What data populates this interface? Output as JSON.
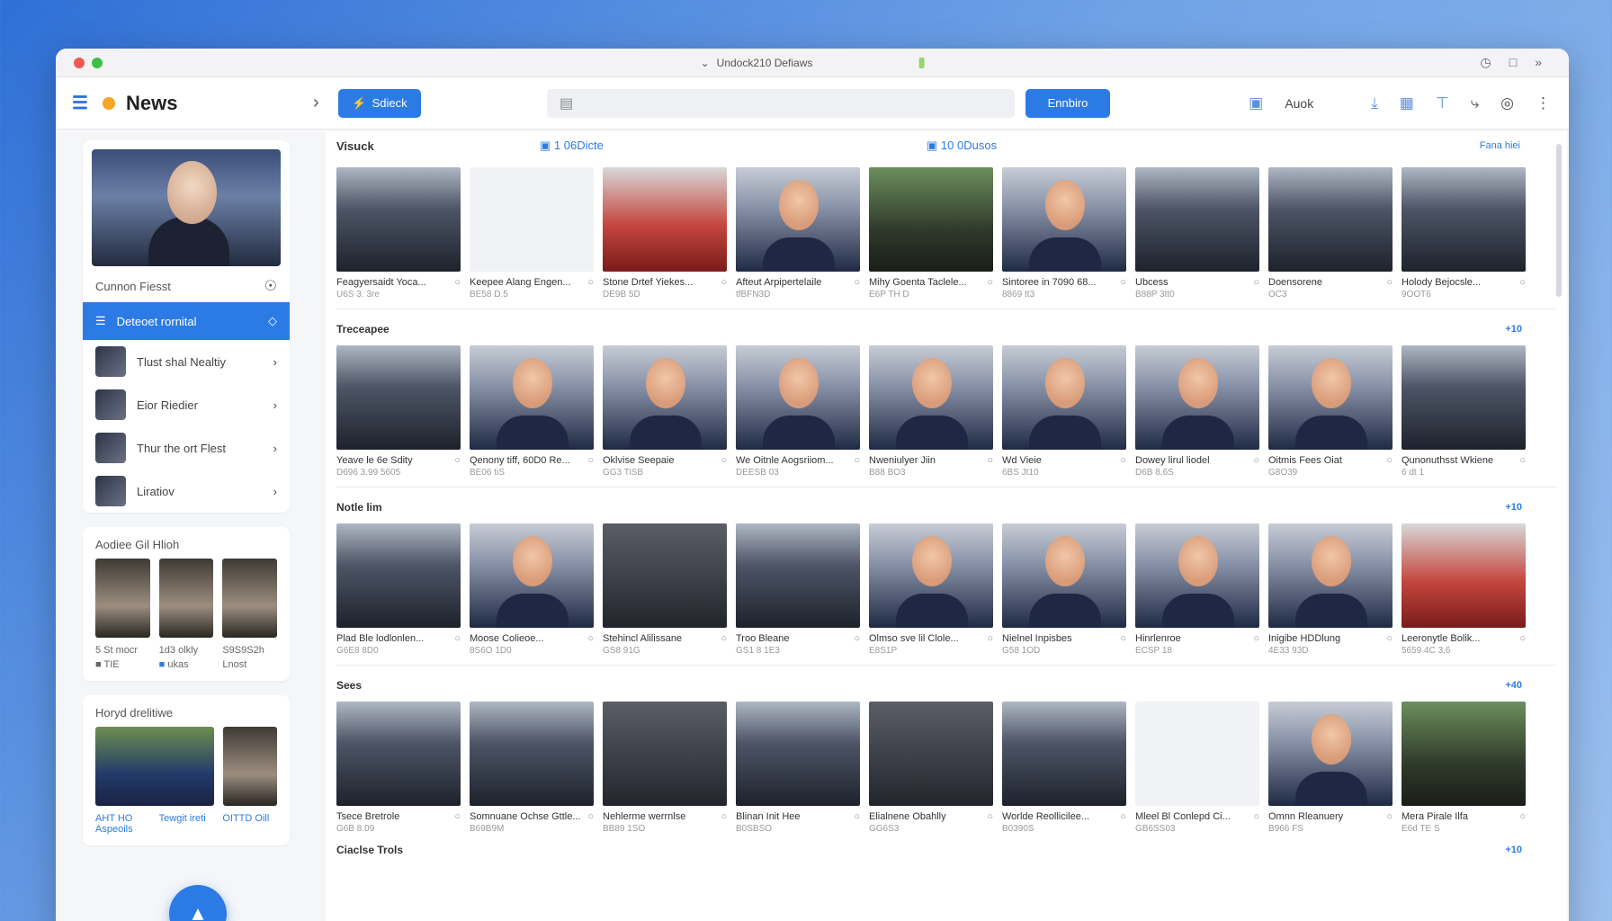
{
  "window": {
    "title": "Undock210 Defiaws"
  },
  "toolbar": {
    "app_title": "News",
    "primary_button": "Sdieck",
    "search_placeholder": "",
    "action_button": "Ennbiro",
    "text_item": "Auok"
  },
  "sidebar": {
    "section_title": "Cunnon Fiesst",
    "items": [
      {
        "label": "Deteoet rornital"
      },
      {
        "label": "Tlust shal Nealtiy"
      },
      {
        "label": "Eior Riedier"
      },
      {
        "label": "Thur the ort Flest"
      },
      {
        "label": "Liratiov"
      }
    ],
    "card2_title": "Aodiee Gil Hlioh",
    "card2_caps": [
      "5 St mocr",
      "1d3 olkly",
      "S9S9S2h"
    ],
    "card2_caps2": [
      "TIE",
      "ukas",
      "Lnost"
    ],
    "card3_title": "Horyd drelitiwe",
    "card3_caps": [
      "AHT HO Aspeoils",
      "Tewgit ireti",
      "OITTD Oill"
    ]
  },
  "main": {
    "view_label": "Visuck",
    "tag1": "1 06Dicte",
    "tag2": "10 0Dusos",
    "tag3": "Fana hiei",
    "sections": [
      {
        "title": "",
        "more": "",
        "tiles": [
          {
            "cap": "Feagyersaidt Yoca...",
            "sub": "U6S 3. 3re"
          },
          {
            "cap": "Keepee Alang Engen...",
            "sub": "BE58 D.5"
          },
          {
            "cap": "Stone Drtef Yiekes...",
            "sub": "DE9B 5D"
          },
          {
            "cap": "Afteut Arpipertelaile",
            "sub": "tfBFN3D"
          },
          {
            "cap": "Mihy Goenta Taclele...",
            "sub": "E6P TH D"
          },
          {
            "cap": "Sintoree in 7090 68...",
            "sub": "8869 tt3"
          },
          {
            "cap": "Ubcess",
            "sub": "B88P 3tt0"
          },
          {
            "cap": "Doensorene",
            "sub": "OC3"
          },
          {
            "cap": "Holody Bejocsle...",
            "sub": "9OOT6"
          }
        ]
      },
      {
        "title": "Treceapee",
        "more": "+10",
        "tiles": [
          {
            "cap": "Yeave le 6e Sdity",
            "sub": "D696 3.99 5605"
          },
          {
            "cap": "Qenony tiff, 60D0 Re...",
            "sub": "BE06 tiS"
          },
          {
            "cap": "Oklvise Seepaie",
            "sub": "GG3 TiSB"
          },
          {
            "cap": "We Oitnle Aogsriiom...",
            "sub": "DEESB 03"
          },
          {
            "cap": "Nweniulyer Jiin",
            "sub": "B88 BO3"
          },
          {
            "cap": "Wd Vieie",
            "sub": "6BS Jt10"
          },
          {
            "cap": "Dowey lirul liodel",
            "sub": "D6B 8.6S"
          },
          {
            "cap": "Oitmis Fees Oiat",
            "sub": "G8O39"
          },
          {
            "cap": "Qunonuthsst Wkiene",
            "sub": "6 dt 1"
          }
        ]
      },
      {
        "title": "Notle lim",
        "more": "+10",
        "tiles": [
          {
            "cap": "Plad Ble lodlonlen...",
            "sub": "G6E8 8D0"
          },
          {
            "cap": "Moose Colieoe...",
            "sub": "8S6O 1D0"
          },
          {
            "cap": "Stehincl Alilissane",
            "sub": "GS8 91G"
          },
          {
            "cap": "Troo Bleane",
            "sub": "GS1 8 1E3"
          },
          {
            "cap": "Olmso sve lil Clole...",
            "sub": "E8S1P"
          },
          {
            "cap": "Nielnel Inpisbes",
            "sub": "G58 1OD"
          },
          {
            "cap": "Hinrlenroe",
            "sub": "ECSP 18"
          },
          {
            "cap": "Inigibe HDDlung",
            "sub": "4E33 93D"
          },
          {
            "cap": "Leeronytle Bolik...",
            "sub": "5659 4C 3,6"
          }
        ]
      },
      {
        "title": "Sees",
        "more": "+40",
        "tiles": [
          {
            "cap": "Tsece Bretrole",
            "sub": "G6B 8.09"
          },
          {
            "cap": "Somnuane Ochse Gttle...",
            "sub": "B69B9M"
          },
          {
            "cap": "Nehlerme werrnlse",
            "sub": "BB89 1SO"
          },
          {
            "cap": "Blinan Init Hee",
            "sub": "B0SBSO"
          },
          {
            "cap": "Elialnene Obahlly",
            "sub": "GG6S3"
          },
          {
            "cap": "Worlde Reollicilee...",
            "sub": "B0390S"
          },
          {
            "cap": "Mleel Bl Conlepd Ci...",
            "sub": "GB6SS03"
          },
          {
            "cap": "Omnn Rleanuery",
            "sub": "B966 FS"
          },
          {
            "cap": "Mera Pirale Ilfa",
            "sub": "E6d TE S"
          }
        ]
      }
    ],
    "footer_section": "Ciaclse Trols",
    "footer_more": "+10"
  }
}
